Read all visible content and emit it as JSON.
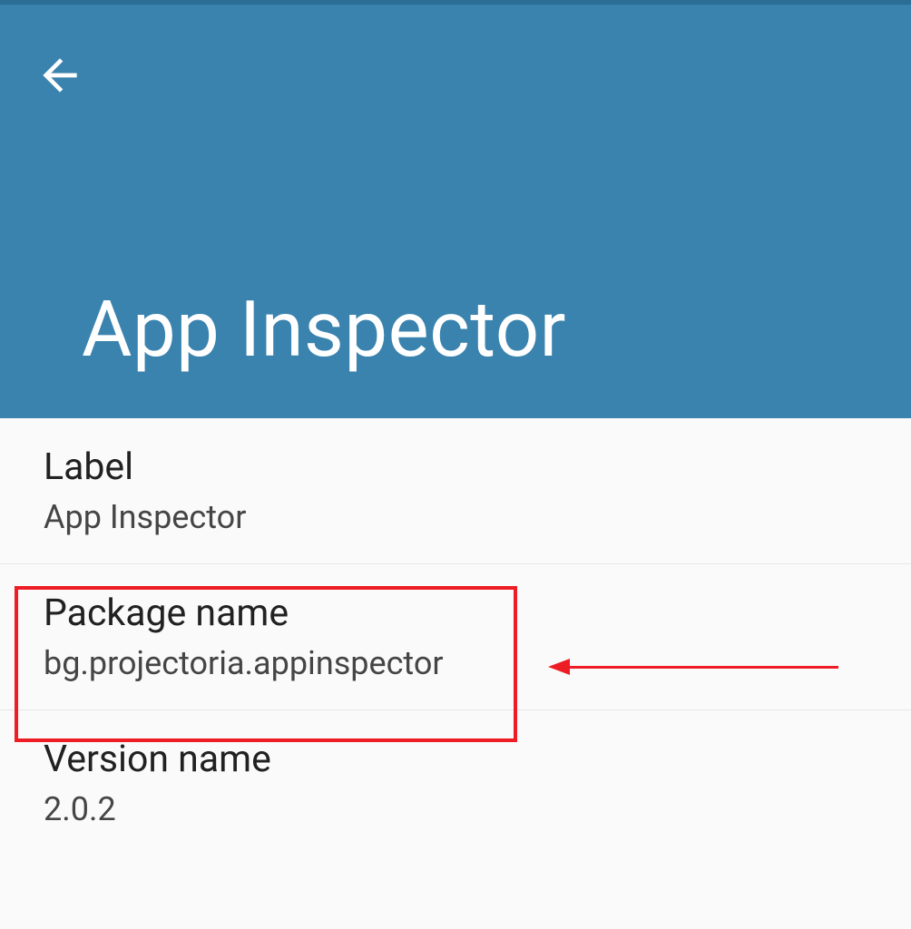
{
  "header": {
    "title": "App Inspector"
  },
  "items": [
    {
      "title": "Label",
      "value": "App Inspector"
    },
    {
      "title": "Package name",
      "value": "bg.projectoria.appinspector"
    },
    {
      "title": "Version name",
      "value": "2.0.2"
    }
  ],
  "annotation": {
    "highlight_index": 1
  }
}
